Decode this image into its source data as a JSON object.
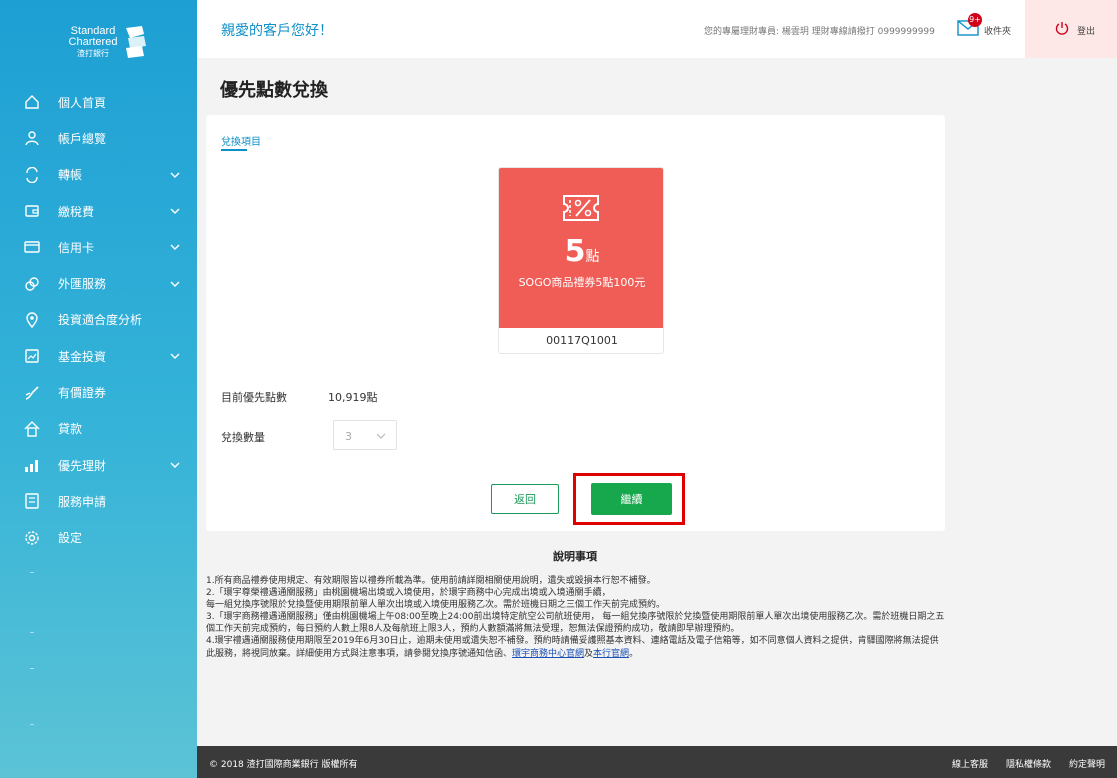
{
  "brand": {
    "line1": "Standard",
    "line2": "Chartered",
    "line3": "渣打銀行"
  },
  "sidebar": {
    "items": [
      {
        "label": "個人首頁",
        "icon": "home-icon",
        "has_submenu": false
      },
      {
        "label": "帳戶總覽",
        "icon": "user-icon",
        "has_submenu": false
      },
      {
        "label": "轉帳",
        "icon": "transfer-icon",
        "has_submenu": true
      },
      {
        "label": "繳稅費",
        "icon": "wallet-icon",
        "has_submenu": true
      },
      {
        "label": "信用卡",
        "icon": "credit-card-icon",
        "has_submenu": true
      },
      {
        "label": "外匯服務",
        "icon": "currency-icon",
        "has_submenu": true
      },
      {
        "label": "投資適合度分析",
        "icon": "location-pin-icon",
        "has_submenu": false
      },
      {
        "label": "基金投資",
        "icon": "chart-box-icon",
        "has_submenu": true
      },
      {
        "label": "有價證券",
        "icon": "stock-icon",
        "has_submenu": false
      },
      {
        "label": "貸款",
        "icon": "house-loan-icon",
        "has_submenu": false
      },
      {
        "label": "優先理財",
        "icon": "bar-chart-icon",
        "has_submenu": true
      },
      {
        "label": "服務申請",
        "icon": "form-icon",
        "has_submenu": false
      },
      {
        "label": "設定",
        "icon": "gear-icon",
        "has_submenu": false
      }
    ]
  },
  "header": {
    "greeting": "親愛的客戶您好！",
    "advisor": "您的專屬理財專員: 楊雲玥 理財專線請撥打 0999999999",
    "mail_badge": "9+",
    "inbox": "收件夾",
    "logout": "登出"
  },
  "page_title": "優先點數兌換",
  "card": {
    "tab": "兌換項目",
    "coupon": {
      "points_value": "5",
      "points_unit": "點",
      "name": "SOGO商品禮券5點100元",
      "code": "00117Q1001"
    },
    "current_points_label": "目前優先點數",
    "current_points_value": "10,919點",
    "quantity_label": "兌換數量",
    "quantity_value": "3",
    "back_button": "返回",
    "continue_button": "繼續"
  },
  "notes": {
    "title": "說明事項",
    "p1": "1.所有商品禮券使用規定、有效期限皆以禮券所載為準。使用前請詳閱相關使用說明，遺失或毀損本行恕不補發。",
    "p2": "2.「環宇尊榮禮遇通關服務」由桃園機場出境或入境使用，於環宇商務中心完成出境或入境通關手續，",
    "p3": "每一組兌換序號限於兌換暨使用期限前單人單次出境或入境使用服務乙次。需於班機日期之三個工作天前完成預約。",
    "p4": "3.「環宇商務禮遇通關服務」僅由桃園機場上午08:00至晚上24:00前出境特定航空公司航班使用， 每一組兌換序號限於兌換暨使用期限前單人單次出境使用服務乙次。需於班機日期之五個工作天前完成預約，每日預約人數上限8人及每航班上限3人，預約人數額滿將無法受理，恕無法保證預約成功，敬請即早辦理預約。",
    "p5": "4.環宇禮遇通關服務使用期限至2019年6月30日止，逾期未使用或遺失恕不補發。預約時請備妥護照基本資料、連絡電話及電子信箱等，如不同意個人資料之提供，肯驛國際將無法提供此服務，將視同放棄。詳細使用方式與注意事項，請參閱兌換序號通知信函、",
    "link1": "環宇商務中心官網",
    "and": "及",
    "link2": "本行官網",
    "end": "。"
  },
  "footer": {
    "copyright": "© 2018 渣打國際商業銀行 版權所有",
    "links": [
      "線上客服",
      "隱私權條款",
      "約定聲明"
    ]
  },
  "colors": {
    "sidebar_top": "#1d9fd4",
    "coupon_red": "#f05d57",
    "continue_green": "#17a84e",
    "highlight_red": "#e00000",
    "link_blue": "#0d8fc8"
  }
}
